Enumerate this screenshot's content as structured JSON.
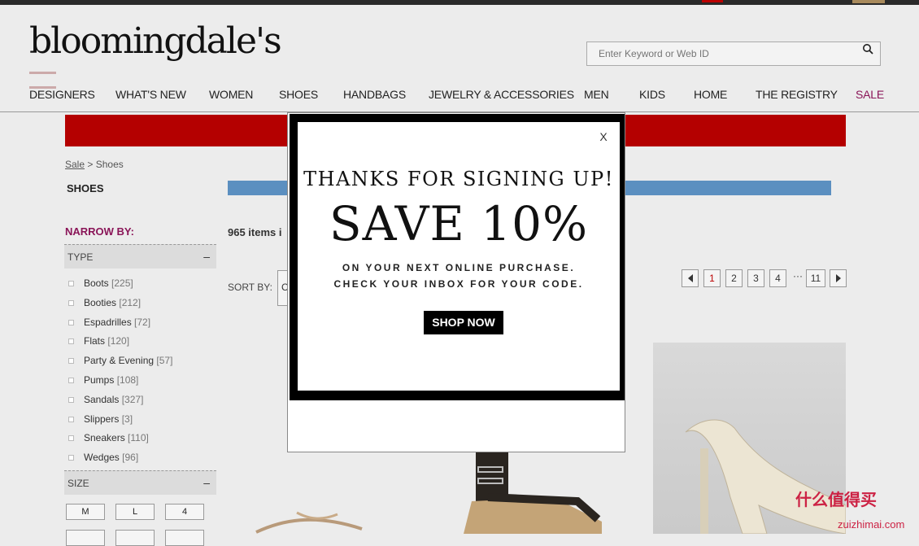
{
  "header": {
    "logo_text": "bloomingdale's",
    "search_placeholder": "Enter Keyword or Web ID"
  },
  "nav": {
    "items": [
      "DESIGNERS",
      "WHAT'S NEW",
      "WOMEN",
      "SHOES",
      "HANDBAGS",
      "JEWELRY & ACCESSORIES",
      "MEN",
      "KIDS",
      "HOME",
      "THE REGISTRY",
      "SALE"
    ]
  },
  "breadcrumb": {
    "parent": "Sale",
    "separator": ">",
    "current": "Shoes"
  },
  "page_title": "SHOES",
  "sidebar": {
    "narrow_by": "NARROW BY:",
    "type_heading": "TYPE",
    "type_filters": [
      {
        "label": "Boots",
        "count": "[225]"
      },
      {
        "label": "Booties",
        "count": "[212]"
      },
      {
        "label": "Espadrilles",
        "count": "[72]"
      },
      {
        "label": "Flats",
        "count": "[120]"
      },
      {
        "label": "Party & Evening",
        "count": "[57]"
      },
      {
        "label": "Pumps",
        "count": "[108]"
      },
      {
        "label": "Sandals",
        "count": "[327]"
      },
      {
        "label": "Slippers",
        "count": "[3]"
      },
      {
        "label": "Sneakers",
        "count": "[110]"
      },
      {
        "label": "Wedges",
        "count": "[96]"
      }
    ],
    "size_heading": "SIZE",
    "sizes": [
      "M",
      "L",
      "4"
    ],
    "collapse_symbol": "–"
  },
  "results": {
    "count_text": "965 items i",
    "sort_label": "SORT BY:",
    "sort_value": "C"
  },
  "pagination": {
    "pages": [
      "1",
      "2",
      "3",
      "4",
      "11"
    ],
    "ellipsis": "···",
    "current_page": "1"
  },
  "modal": {
    "close_label": "X",
    "headline": "THANKS FOR SIGNING UP!",
    "offer": "SAVE 10%",
    "line1": "ON YOUR NEXT ONLINE PURCHASE.",
    "line2": "CHECK YOUR INBOX FOR YOUR CODE.",
    "cta": "SHOP NOW"
  },
  "watermark": {
    "text": "什么值得买",
    "url": "zuizhimai.com"
  },
  "colors": {
    "promo_bar": "#b40000",
    "sale_nav": "#8a1558",
    "narrow_by": "#8a1558",
    "banner_strip": "#5b8fc0"
  }
}
